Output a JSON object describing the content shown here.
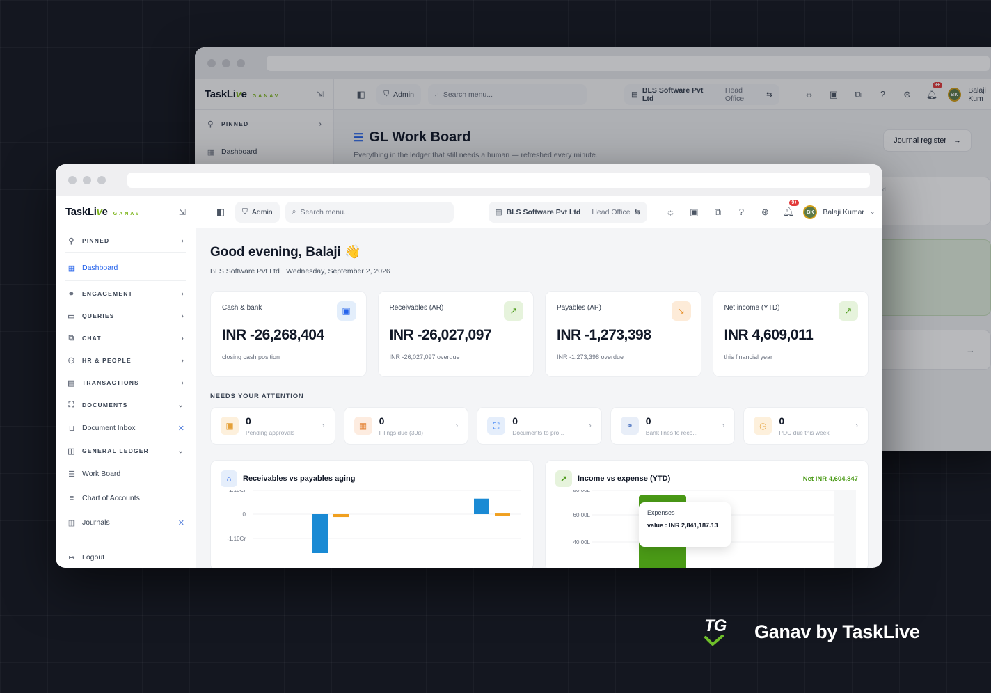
{
  "brand": {
    "name_pre": "TaskLi",
    "name_v": "v",
    "name_post": "e",
    "sub": "GANAV"
  },
  "back_window": {
    "admin": "Admin",
    "search_placeholder": "Search menu...",
    "company": "BLS Software Pvt Ltd",
    "office": "Head Office",
    "user": "Balaji Kum",
    "avatar": "BK",
    "badge": "9+",
    "pinned": "PINNED",
    "dashboard": "Dashboard",
    "title": "GL Work Board",
    "subtitle": "Everything in the ledger that still needs a human — refreshed every minute.",
    "journal_button": "Journal register",
    "card_fragment": "ved"
  },
  "topbar": {
    "admin": "Admin",
    "search_placeholder": "Search menu...",
    "company": "BLS Software Pvt Ltd",
    "office": "Head Office",
    "user": "Balaji Kumar",
    "avatar": "BK",
    "badge": "9+"
  },
  "sidebar": {
    "items": [
      {
        "label": "PINNED",
        "group": true
      },
      {
        "label": "Dashboard",
        "active": true
      },
      {
        "label": "ENGAGEMENT",
        "group": true
      },
      {
        "label": "QUERIES",
        "group": true
      },
      {
        "label": "CHAT",
        "group": true
      },
      {
        "label": "HR & PEOPLE",
        "group": true
      },
      {
        "label": "TRANSACTIONS",
        "group": true
      },
      {
        "label": "DOCUMENTS",
        "group": true
      },
      {
        "label": "Document Inbox"
      },
      {
        "label": "GENERAL LEDGER",
        "group": true
      },
      {
        "label": "Work Board"
      },
      {
        "label": "Chart of Accounts"
      },
      {
        "label": "Journals"
      },
      {
        "label": "Logout"
      }
    ]
  },
  "main": {
    "greeting": "Good evening, Balaji 👋",
    "subtitle": "BLS Software Pvt Ltd · Wednesday, September 2, 2026",
    "kpis": [
      {
        "label": "Cash & bank",
        "value": "INR -26,268,404",
        "note": "closing cash position"
      },
      {
        "label": "Receivables (AR)",
        "value": "INR -26,027,097",
        "note": "INR -26,027,097 overdue"
      },
      {
        "label": "Payables (AP)",
        "value": "INR -1,273,398",
        "note": "INR -1,273,398 overdue"
      },
      {
        "label": "Net income (YTD)",
        "value": "INR 4,609,011",
        "note": "this financial year"
      }
    ],
    "attention_label": "NEEDS YOUR ATTENTION",
    "attention": [
      {
        "count": "0",
        "label": "Pending approvals"
      },
      {
        "count": "0",
        "label": "Filings due (30d)"
      },
      {
        "count": "0",
        "label": "Documents to pro..."
      },
      {
        "count": "0",
        "label": "Bank lines to reco..."
      },
      {
        "count": "0",
        "label": "PDC due this week"
      }
    ],
    "chart1": {
      "title": "Receivables vs payables aging"
    },
    "chart2": {
      "title": "Income vs expense (YTD)",
      "net": "Net INR 4,604,847"
    },
    "tooltip": {
      "label": "Expenses",
      "value": "value : INR 2,841,187.13"
    }
  },
  "chart_data": [
    {
      "type": "bar",
      "title": "Receivables vs payables aging",
      "yticks": [
        "1.10Cr",
        "0",
        "-1.10Cr"
      ],
      "ylim": [
        -11000000,
        11000000
      ],
      "series": [
        {
          "values": [
            -26027097,
            7000000
          ],
          "color": "#1a8ad4"
        },
        {
          "values": [
            -1273398,
            300000
          ],
          "color": "#f0a020"
        }
      ]
    },
    {
      "type": "bar",
      "title": "Income vs expense (YTD)",
      "yticks": [
        "80.00L",
        "60.00L",
        "40.00L"
      ],
      "ylim": [
        0,
        8000000
      ],
      "series": [
        {
          "name": "Expenses",
          "values": [
            2841187.13
          ],
          "color": "#4a9a16"
        }
      ]
    }
  ],
  "footer": {
    "brand_text": "Ganav by TaskLive",
    "logo": "TG"
  },
  "colors": {
    "accent": "#2563eb",
    "brand_green": "#7ab317",
    "bg": "#141720"
  }
}
